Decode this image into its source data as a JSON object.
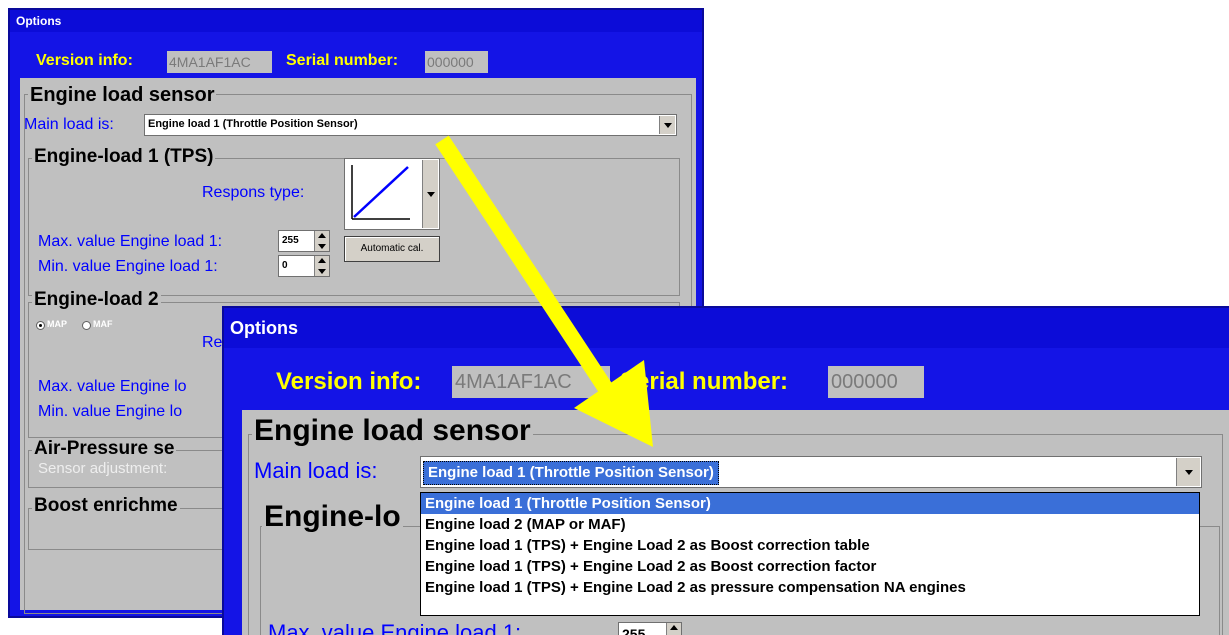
{
  "window_back": {
    "title": "Options",
    "version_label": "Version info:",
    "version_value": "4MA1AF1AC",
    "serial_label": "Serial number:",
    "serial_value": "000000",
    "engine_load_sensor_title": "Engine load sensor",
    "main_load_label": "Main load is:",
    "main_load_value": "Engine load 1 (Throttle Position Sensor)",
    "engine_load1_title": "Engine-load 1 (TPS)",
    "respons_type_label": "Respons type:",
    "max_value_label": "Max. value Engine load 1:",
    "max_value": "255",
    "min_value_label": "Min.  value Engine load 1:",
    "min_value": "0",
    "auto_cal_button": "Automatic cal.",
    "engine_load2_title": "Engine-load 2",
    "radio_map": "MAP",
    "radio_maf": "MAF",
    "radio_selected": "MAP",
    "respons_partial": "Re",
    "max_value2_label_partial": "Max. value Engine lo",
    "min_value2_label_partial": "Min.  value Engine lo",
    "air_pressure_title": "Air-Pressure se",
    "sensor_adjustment_label": "Sensor adjustment:",
    "boost_title": "Boost enrichme"
  },
  "window_front": {
    "title": "Options",
    "version_label": "Version info:",
    "version_value": "4MA1AF1AC",
    "serial_label": "Serial number:",
    "serial_value": "000000",
    "engine_load_sensor_title": "Engine load sensor",
    "main_load_label": "Main load is:",
    "main_load_value": "Engine load 1 (Throttle Position Sensor)",
    "engine_load_partial": "Engine-lo",
    "dropdown_options": [
      "Engine load 1 (Throttle Position Sensor)",
      "Engine load 2 (MAP or MAF)",
      "Engine load 1 (TPS) + Engine Load 2 as Boost correction table",
      "Engine load 1 (TPS) + Engine Load 2 as Boost correction factor",
      "Engine load 1 (TPS) + Engine Load 2 as pressure compensation NA engines"
    ],
    "selected_option": "Engine load 1 (Throttle Position Sensor)",
    "max_value_label_partial": "Max. value Engine load 1:",
    "max_value": "255"
  },
  "colors": {
    "window_blue": "#1414e6",
    "label_yellow": "#ffff00",
    "label_blue": "#0000ff",
    "panel_gray": "#c0c0c0",
    "arrow_yellow": "#ffff00",
    "selection_blue": "#3a6fd8"
  },
  "icons": {
    "arrow": "yellow-arrow-icon",
    "response_curve": "linear-response-curve-icon"
  }
}
